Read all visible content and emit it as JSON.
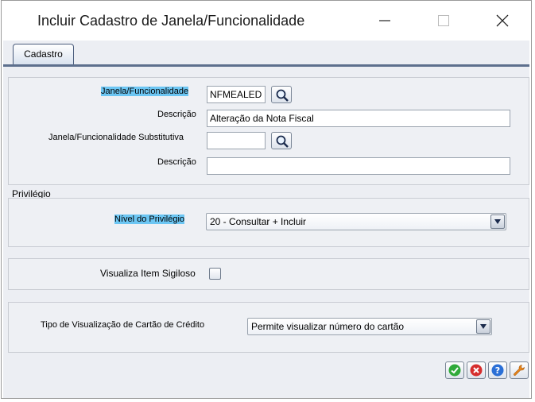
{
  "window": {
    "title": "Incluir Cadastro de Janela/Funcionalidade"
  },
  "tabs": [
    {
      "label": "Cadastro"
    }
  ],
  "cadastro": {
    "janela_label": "Janela/Funcionalidade",
    "janela_value": "NFMEALED",
    "descricao_label": "Descrição",
    "descricao_value": "Alteração da Nota Fiscal",
    "substitutiva_label": "Janela/Funcionalidade Substitutiva",
    "substitutiva_value": "",
    "descricao2_label": "Descrição",
    "descricao2_value": ""
  },
  "privilegio": {
    "section_title": "Privilégio",
    "nivel_label": "Nível do Privilégio",
    "nivel_value": "20 - Consultar + Incluir"
  },
  "sigiloso": {
    "label": "Visualiza Item Sigiloso",
    "checked": false
  },
  "cartao": {
    "label": "Tipo de Visualização de Cartão de Crédito",
    "value": "Permite visualizar número do cartão"
  },
  "actions": {
    "confirm": "check-icon",
    "cancel": "cancel-icon",
    "help": "help-icon",
    "tools": "wrench-icon"
  },
  "colors": {
    "highlight": "#6cc6f3",
    "tab_border": "#5d6f8d",
    "background": "#eceef3"
  }
}
